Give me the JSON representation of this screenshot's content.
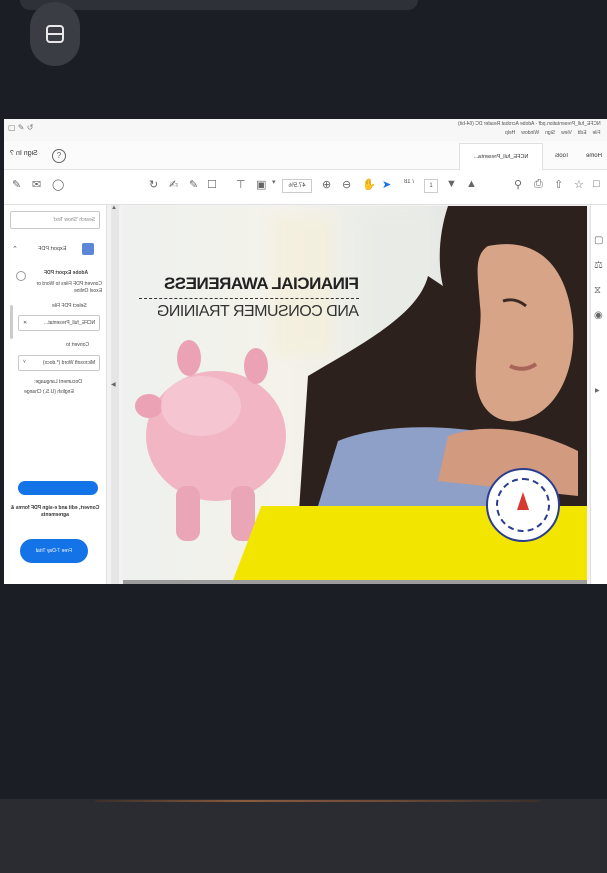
{
  "window": {
    "title": "NCFE_full_Presentation.pdf - Adobe Acrobat Reader DC (64-bit)",
    "menu": [
      "File",
      "Edit",
      "View",
      "Sign",
      "Window",
      "Help"
    ]
  },
  "tabs": {
    "home": "Home",
    "tools": "Tools",
    "document_tab": "NCFE_full_Presenta...",
    "sign_in": "Sign In"
  },
  "toolbar": {
    "page_current": "1",
    "page_total": "/ 18",
    "zoom": "47.5%"
  },
  "left_panel": {
    "search_placeholder": "Search 'Show Text'",
    "export_title": "Export PDF",
    "product_name": "Adobe Export PDF",
    "description": "Convert PDF Files to Word or Excel Online",
    "select_file_label": "Select PDF File",
    "file_name": "NCFE_full_Presentat...",
    "convert_to_label": "Convert to",
    "convert_option": "Microsoft Word (*.docx)",
    "language_label": "Document Language:",
    "language_value": "English (U.S.) Change",
    "promo_text": "Convert, edit and e-sign PDF forms & agreements",
    "trial_button": "Free 7-Day Trial"
  },
  "slide": {
    "title_line1": "FINANCIAL AWARENESS",
    "title_line2": "AND CONSUMER TRAINING",
    "accent_color": "#f2e600",
    "piggy_color": "#f1b5c3"
  },
  "colors": {
    "app_bg": "#1b1e25",
    "acrobat_blue": "#1473e6",
    "slide_yellow": "#f2e600"
  }
}
